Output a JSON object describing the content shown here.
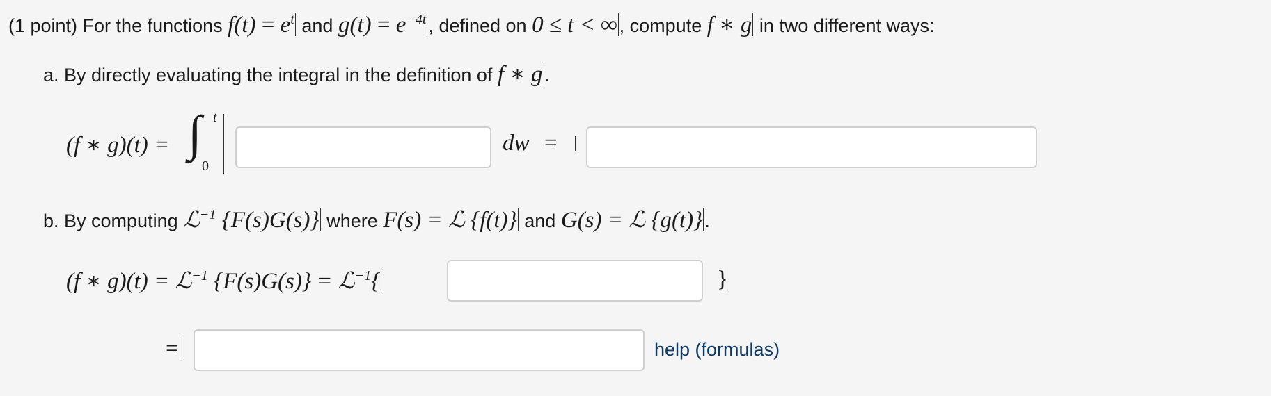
{
  "intro": {
    "points": "(1 point) For the functions",
    "f_def_lhs": "f(t)",
    "f_def_rhs": "e",
    "f_exp": "t",
    "and1": "and",
    "g_def_lhs": "g(t)",
    "g_def_rhs": "e",
    "g_exp": "−4t",
    "defined_on": ", defined on",
    "domain": "0 ≤ t < ∞",
    "compute": ", compute",
    "fg": "f ∗ g",
    "two_ways": "in two different ways:"
  },
  "part_a": {
    "text": "a. By directly evaluating the integral in the definition of",
    "fg": "f ∗ g",
    "period": ".",
    "lhs": "(f ∗ g)(t) =",
    "upper_limit": "t",
    "lower_limit": "0",
    "dw": "dw",
    "eq": "=",
    "integrand_value": "",
    "result_value": ""
  },
  "part_b": {
    "text1": "b. By computing",
    "inv_transform": "ℒ",
    "inv_exp": "−1",
    "braces": "{F(s)G(s)}",
    "where": "where",
    "F_def": "F(s) = ℒ {f(t)}",
    "and2": "and",
    "G_def": "G(s) = ℒ {g(t)}",
    "period": ".",
    "line1_lhs": "(f ∗ g)(t) = ℒ",
    "line1_mid": "{F(s)G(s)} = ℒ",
    "line1_open": "{",
    "line1_close": "}",
    "line2_eq": "=",
    "transform_value": "",
    "final_value": "",
    "help_link": "help (formulas)"
  }
}
